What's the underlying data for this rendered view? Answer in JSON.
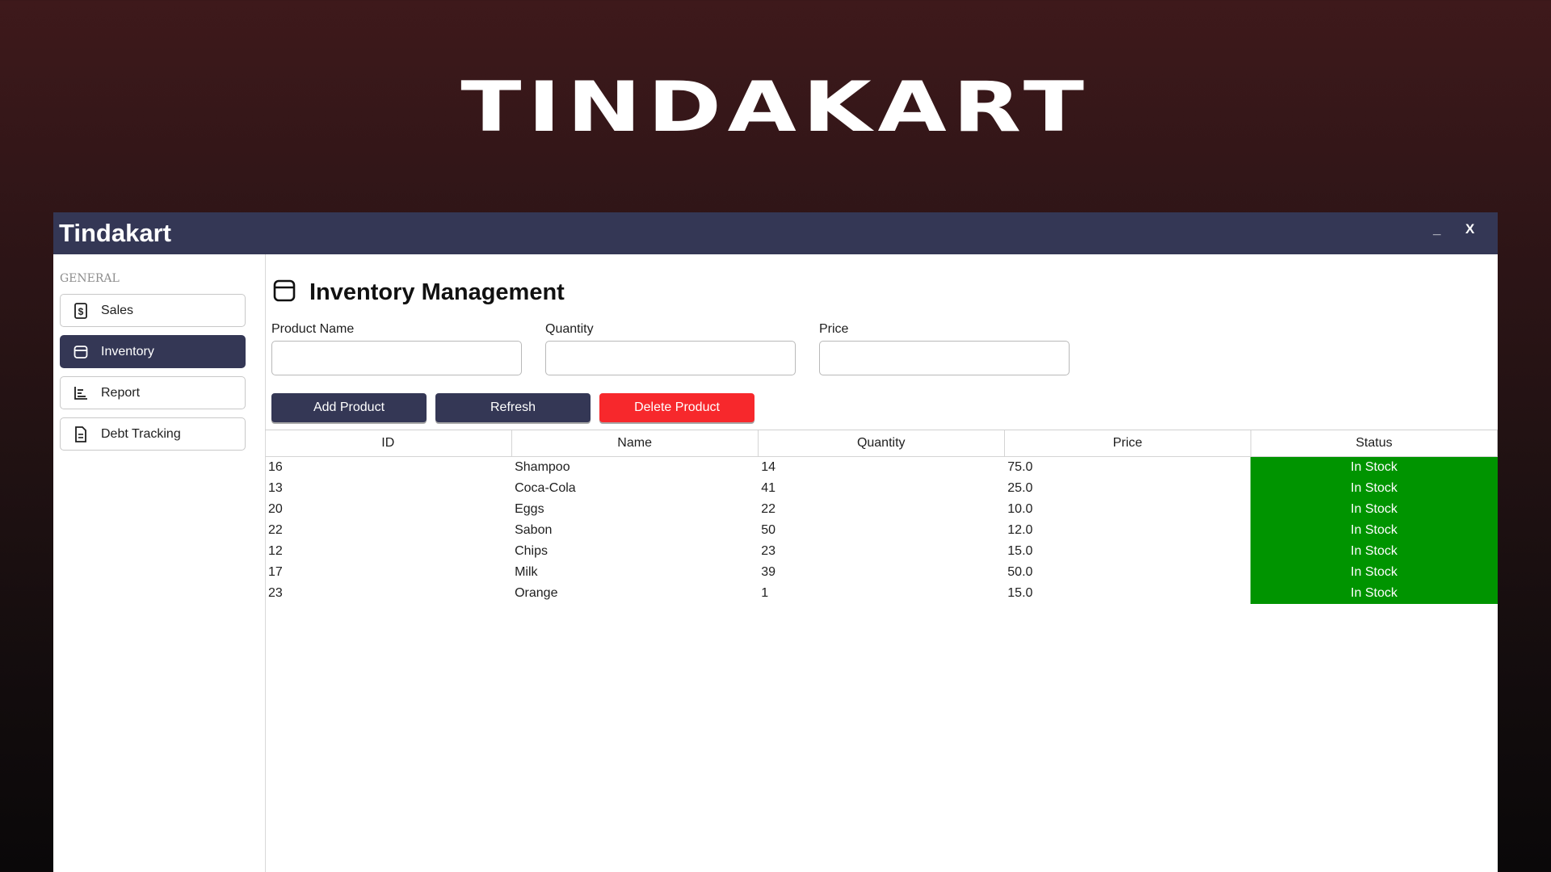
{
  "hero_title": "TINDAKART",
  "window": {
    "title": "Tindakart",
    "minimize_label": "_",
    "close_label": "X"
  },
  "sidebar": {
    "section_label": "GENERAL",
    "items": [
      {
        "label": "Sales",
        "icon": "dollar-receipt-icon",
        "active": false
      },
      {
        "label": "Inventory",
        "icon": "box-icon",
        "active": true
      },
      {
        "label": "Report",
        "icon": "bar-chart-icon",
        "active": false
      },
      {
        "label": "Debt Tracking",
        "icon": "document-icon",
        "active": false
      }
    ]
  },
  "main": {
    "page_title": "Inventory Management",
    "page_icon": "box-icon",
    "fields": {
      "product_name_label": "Product Name",
      "product_name_value": "",
      "quantity_label": "Quantity",
      "quantity_value": "",
      "price_label": "Price",
      "price_value": ""
    },
    "buttons": {
      "add": "Add Product",
      "refresh": "Refresh",
      "delete": "Delete Product"
    },
    "table": {
      "columns": [
        "ID",
        "Name",
        "Quantity",
        "Price",
        "Status"
      ],
      "rows": [
        {
          "id": "16",
          "name": "Shampoo",
          "quantity": "14",
          "price": "75.0",
          "status": "In Stock"
        },
        {
          "id": "13",
          "name": "Coca-Cola",
          "quantity": "41",
          "price": "25.0",
          "status": "In Stock"
        },
        {
          "id": "20",
          "name": "Eggs",
          "quantity": "22",
          "price": "10.0",
          "status": "In Stock"
        },
        {
          "id": "22",
          "name": "Sabon",
          "quantity": "50",
          "price": "12.0",
          "status": "In Stock"
        },
        {
          "id": "12",
          "name": "Chips",
          "quantity": "23",
          "price": "15.0",
          "status": "In Stock"
        },
        {
          "id": "17",
          "name": "Milk",
          "quantity": "39",
          "price": "50.0",
          "status": "In Stock"
        },
        {
          "id": "23",
          "name": "Orange",
          "quantity": "1",
          "price": "15.0",
          "status": "In Stock"
        }
      ]
    }
  },
  "colors": {
    "accent_dark": "#343755",
    "danger": "#f7282c",
    "in_stock": "#009400"
  }
}
